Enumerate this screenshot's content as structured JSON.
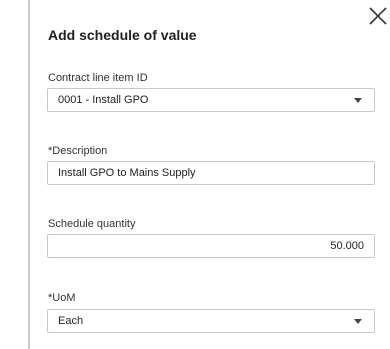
{
  "dialog": {
    "title": "Add schedule of value",
    "close_icon": "close-icon"
  },
  "fields": {
    "contract_line_item": {
      "label": "Contract line item ID",
      "value": "0001 - Install GPO",
      "icon": "chevron-down-icon"
    },
    "description": {
      "required_mark": "*",
      "label": "Description",
      "value": "Install GPO to Mains Supply"
    },
    "schedule_quantity": {
      "label": "Schedule quantity",
      "value": "50.000"
    },
    "uom": {
      "required_mark": "*",
      "label": "UoM",
      "value": "Each",
      "icon": "chevron-down-icon"
    }
  }
}
